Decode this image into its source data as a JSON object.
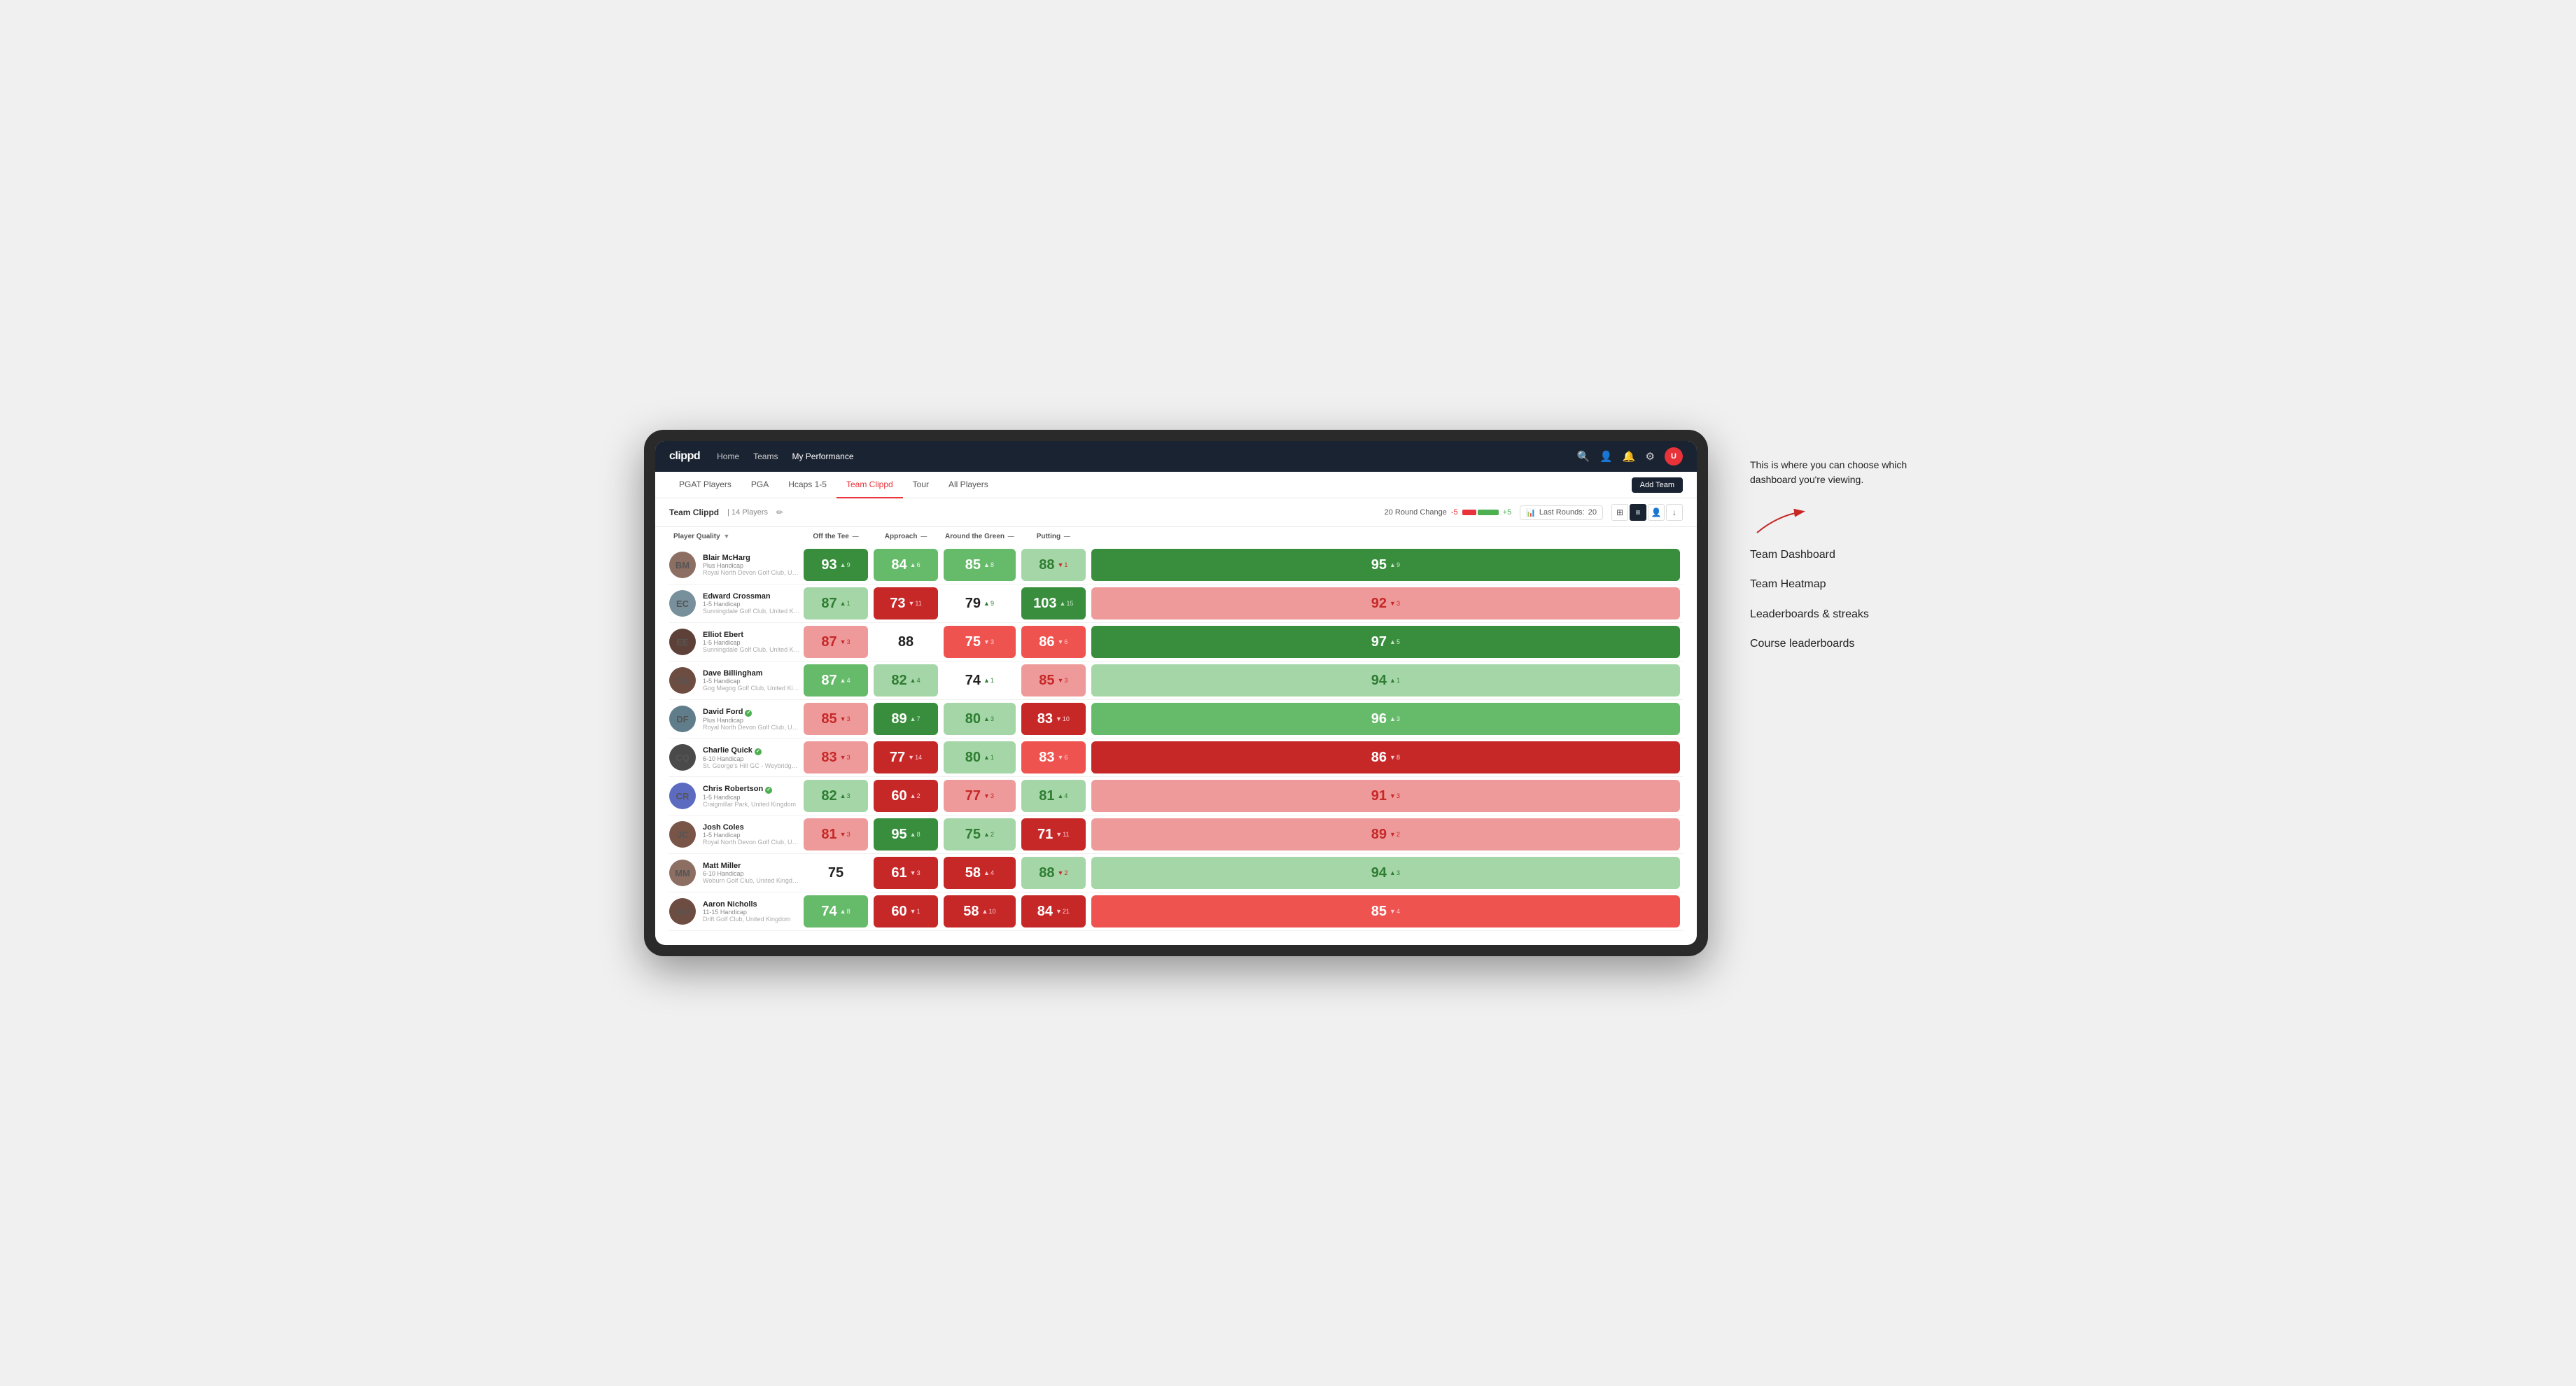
{
  "annotation": {
    "intro_text": "This is where you can choose which dashboard you're viewing.",
    "menu_items": [
      "Team Dashboard",
      "Team Heatmap",
      "Leaderboards & streaks",
      "Course leaderboards"
    ]
  },
  "navbar": {
    "logo": "clippd",
    "links": [
      "Home",
      "Teams",
      "My Performance"
    ],
    "active_link": "My Performance"
  },
  "subnav": {
    "links": [
      "PGAT Players",
      "PGA",
      "Hcaps 1-5",
      "Team Clippd",
      "Tour",
      "All Players"
    ],
    "active_link": "Team Clippd",
    "add_team_label": "Add Team"
  },
  "team_header": {
    "team_name": "Team Clippd",
    "separator": "|",
    "player_count": "14 Players",
    "round_change_label": "20 Round Change",
    "neg_label": "-5",
    "pos_label": "+5",
    "last_rounds_label": "Last Rounds:",
    "last_rounds_value": "20"
  },
  "table": {
    "columns": {
      "player": "Player Quality",
      "off_tee": "Off the Tee",
      "approach": "Approach",
      "around_green": "Around the Green",
      "putting": "Putting"
    },
    "players": [
      {
        "name": "Blair McHarg",
        "handicap": "Plus Handicap",
        "club": "Royal North Devon Golf Club, United Kingdom",
        "initials": "BM",
        "avatar_color": "#8d6e63",
        "scores": {
          "quality": {
            "value": 93,
            "change": "+9",
            "direction": "up",
            "bg": "bg-green-dark"
          },
          "off_tee": {
            "value": 84,
            "change": "+6",
            "direction": "up",
            "bg": "bg-green-med"
          },
          "approach": {
            "value": 85,
            "change": "+8",
            "direction": "up",
            "bg": "bg-green-med"
          },
          "around_green": {
            "value": 88,
            "change": "-1",
            "direction": "down",
            "bg": "bg-green-light"
          },
          "putting": {
            "value": 95,
            "change": "+9",
            "direction": "up",
            "bg": "bg-green-dark"
          }
        }
      },
      {
        "name": "Edward Crossman",
        "handicap": "1-5 Handicap",
        "club": "Sunningdale Golf Club, United Kingdom",
        "initials": "EC",
        "avatar_color": "#78909c",
        "scores": {
          "quality": {
            "value": 87,
            "change": "+1",
            "direction": "up",
            "bg": "bg-green-light"
          },
          "off_tee": {
            "value": 73,
            "change": "-11",
            "direction": "down",
            "bg": "bg-red-dark"
          },
          "approach": {
            "value": 79,
            "change": "+9",
            "direction": "up",
            "bg": "bg-white"
          },
          "around_green": {
            "value": 103,
            "change": "+15",
            "direction": "up",
            "bg": "bg-green-dark"
          },
          "putting": {
            "value": 92,
            "change": "-3",
            "direction": "down",
            "bg": "bg-red-light"
          }
        }
      },
      {
        "name": "Elliot Ebert",
        "handicap": "1-5 Handicap",
        "club": "Sunningdale Golf Club, United Kingdom",
        "initials": "EE",
        "avatar_color": "#5d4037",
        "scores": {
          "quality": {
            "value": 87,
            "change": "-3",
            "direction": "down",
            "bg": "bg-red-light"
          },
          "off_tee": {
            "value": 88,
            "change": "",
            "direction": "",
            "bg": "bg-white"
          },
          "approach": {
            "value": 75,
            "change": "-3",
            "direction": "down",
            "bg": "bg-red-med"
          },
          "around_green": {
            "value": 86,
            "change": "-6",
            "direction": "down",
            "bg": "bg-red-med"
          },
          "putting": {
            "value": 97,
            "change": "+5",
            "direction": "up",
            "bg": "bg-green-dark"
          }
        }
      },
      {
        "name": "Dave Billingham",
        "handicap": "1-5 Handicap",
        "club": "Gog Magog Golf Club, United Kingdom",
        "initials": "DB",
        "avatar_color": "#6d4c41",
        "scores": {
          "quality": {
            "value": 87,
            "change": "+4",
            "direction": "up",
            "bg": "bg-green-med"
          },
          "off_tee": {
            "value": 82,
            "change": "+4",
            "direction": "up",
            "bg": "bg-green-light"
          },
          "approach": {
            "value": 74,
            "change": "+1",
            "direction": "up",
            "bg": "bg-white"
          },
          "around_green": {
            "value": 85,
            "change": "-3",
            "direction": "down",
            "bg": "bg-red-light"
          },
          "putting": {
            "value": 94,
            "change": "+1",
            "direction": "up",
            "bg": "bg-green-light"
          }
        }
      },
      {
        "name": "David Ford",
        "handicap": "Plus Handicap",
        "club": "Royal North Devon Golf Club, United Kingdom",
        "initials": "DF",
        "avatar_color": "#607d8b",
        "verified": true,
        "scores": {
          "quality": {
            "value": 85,
            "change": "-3",
            "direction": "down",
            "bg": "bg-red-light"
          },
          "off_tee": {
            "value": 89,
            "change": "+7",
            "direction": "up",
            "bg": "bg-green-dark"
          },
          "approach": {
            "value": 80,
            "change": "+3",
            "direction": "up",
            "bg": "bg-green-light"
          },
          "around_green": {
            "value": 83,
            "change": "-10",
            "direction": "down",
            "bg": "bg-red-dark"
          },
          "putting": {
            "value": 96,
            "change": "+3",
            "direction": "up",
            "bg": "bg-green-med"
          }
        }
      },
      {
        "name": "Charlie Quick",
        "handicap": "6-10 Handicap",
        "club": "St. George's Hill GC - Weybridge - Surrey, Uni...",
        "initials": "CQ",
        "avatar_color": "#4a4a4a",
        "verified": true,
        "scores": {
          "quality": {
            "value": 83,
            "change": "-3",
            "direction": "down",
            "bg": "bg-red-light"
          },
          "off_tee": {
            "value": 77,
            "change": "-14",
            "direction": "down",
            "bg": "bg-red-dark"
          },
          "approach": {
            "value": 80,
            "change": "+1",
            "direction": "up",
            "bg": "bg-green-light"
          },
          "around_green": {
            "value": 83,
            "change": "-6",
            "direction": "down",
            "bg": "bg-red-med"
          },
          "putting": {
            "value": 86,
            "change": "-8",
            "direction": "down",
            "bg": "bg-red-dark"
          }
        }
      },
      {
        "name": "Chris Robertson",
        "handicap": "1-5 Handicap",
        "club": "Craigmillar Park, United Kingdom",
        "initials": "CR",
        "avatar_color": "#5c6bc0",
        "verified": true,
        "scores": {
          "quality": {
            "value": 82,
            "change": "+3",
            "direction": "up",
            "bg": "bg-green-light"
          },
          "off_tee": {
            "value": 60,
            "change": "+2",
            "direction": "up",
            "bg": "bg-red-dark"
          },
          "approach": {
            "value": 77,
            "change": "-3",
            "direction": "down",
            "bg": "bg-red-light"
          },
          "around_green": {
            "value": 81,
            "change": "+4",
            "direction": "up",
            "bg": "bg-green-light"
          },
          "putting": {
            "value": 91,
            "change": "-3",
            "direction": "down",
            "bg": "bg-red-light"
          }
        }
      },
      {
        "name": "Josh Coles",
        "handicap": "1-5 Handicap",
        "club": "Royal North Devon Golf Club, United Kingdom",
        "initials": "JC",
        "avatar_color": "#795548",
        "scores": {
          "quality": {
            "value": 81,
            "change": "-3",
            "direction": "down",
            "bg": "bg-red-light"
          },
          "off_tee": {
            "value": 95,
            "change": "+8",
            "direction": "up",
            "bg": "bg-green-dark"
          },
          "approach": {
            "value": 75,
            "change": "+2",
            "direction": "up",
            "bg": "bg-green-light"
          },
          "around_green": {
            "value": 71,
            "change": "-11",
            "direction": "down",
            "bg": "bg-red-dark"
          },
          "putting": {
            "value": 89,
            "change": "-2",
            "direction": "down",
            "bg": "bg-red-light"
          }
        }
      },
      {
        "name": "Matt Miller",
        "handicap": "6-10 Handicap",
        "club": "Woburn Golf Club, United Kingdom",
        "initials": "MM",
        "avatar_color": "#8d6e63",
        "scores": {
          "quality": {
            "value": 75,
            "change": "",
            "direction": "",
            "bg": "bg-white"
          },
          "off_tee": {
            "value": 61,
            "change": "-3",
            "direction": "down",
            "bg": "bg-red-dark"
          },
          "approach": {
            "value": 58,
            "change": "+4",
            "direction": "up",
            "bg": "bg-red-dark"
          },
          "around_green": {
            "value": 88,
            "change": "-2",
            "direction": "down",
            "bg": "bg-green-light"
          },
          "putting": {
            "value": 94,
            "change": "+3",
            "direction": "up",
            "bg": "bg-green-light"
          }
        }
      },
      {
        "name": "Aaron Nicholls",
        "handicap": "11-15 Handicap",
        "club": "Drift Golf Club, United Kingdom",
        "initials": "AN",
        "avatar_color": "#6d4c41",
        "scores": {
          "quality": {
            "value": 74,
            "change": "+8",
            "direction": "up",
            "bg": "bg-green-med"
          },
          "off_tee": {
            "value": 60,
            "change": "-1",
            "direction": "down",
            "bg": "bg-red-dark"
          },
          "approach": {
            "value": 58,
            "change": "+10",
            "direction": "up",
            "bg": "bg-red-dark"
          },
          "around_green": {
            "value": 84,
            "change": "-21",
            "direction": "down",
            "bg": "bg-red-dark"
          },
          "putting": {
            "value": 85,
            "change": "-4",
            "direction": "down",
            "bg": "bg-red-med"
          }
        }
      }
    ]
  }
}
